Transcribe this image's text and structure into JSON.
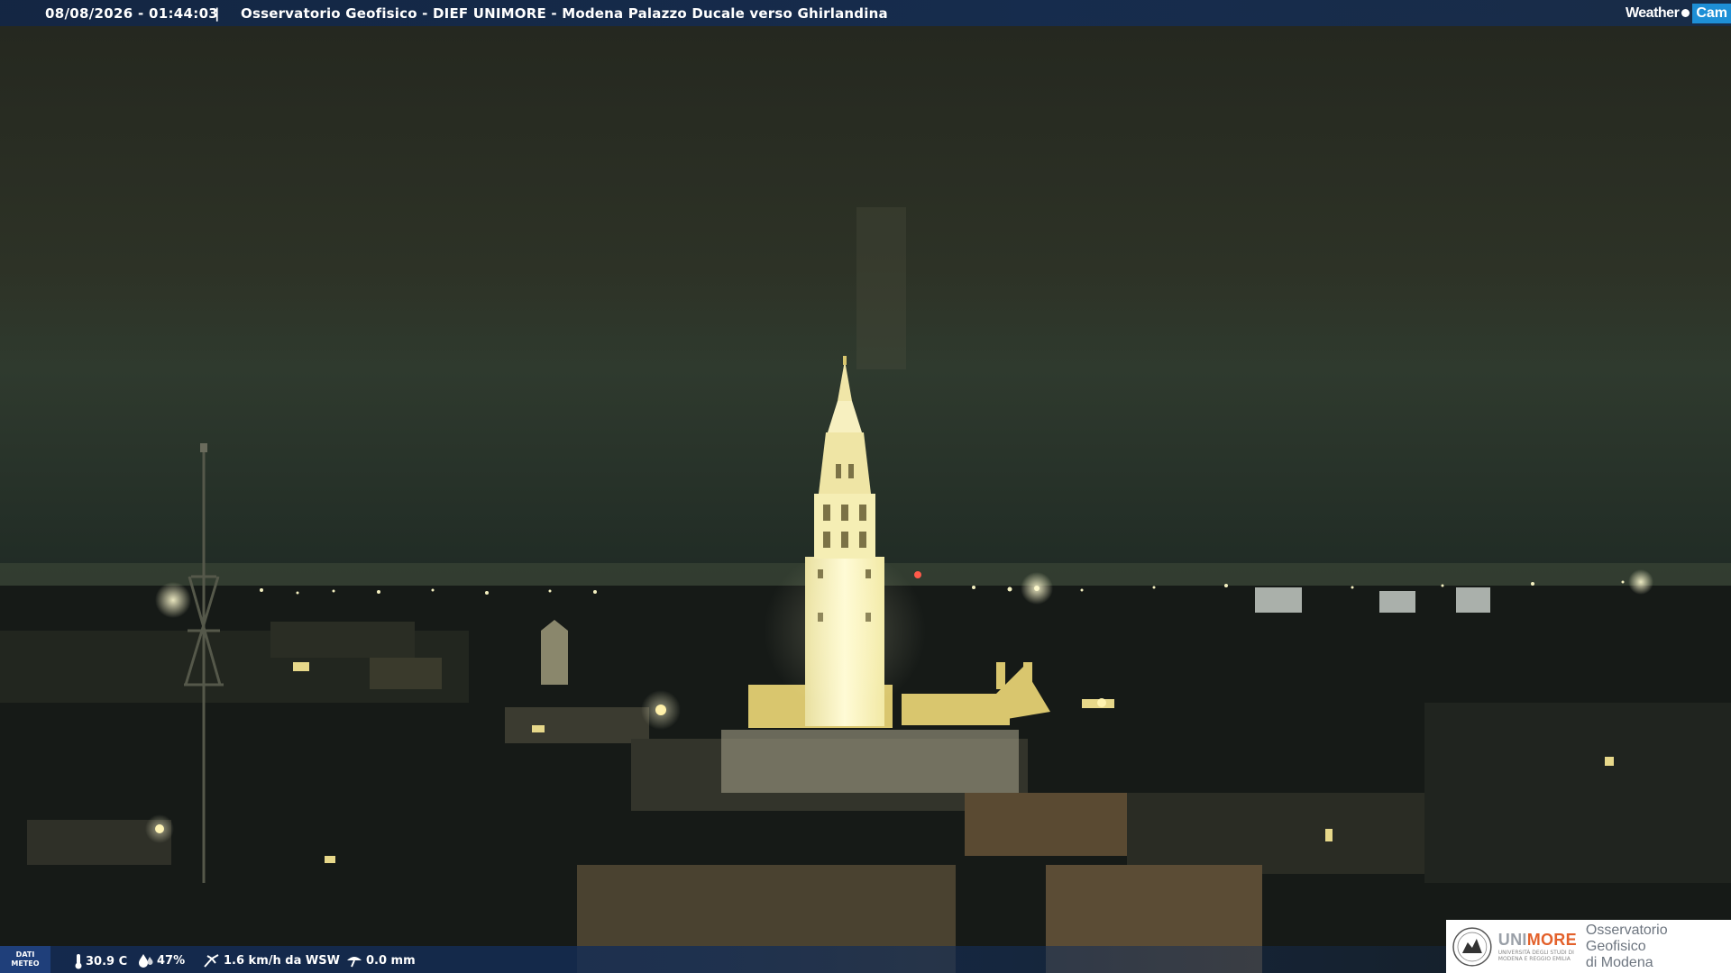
{
  "overlay": {
    "timestamp": "08/08/2026 - 01:44:03",
    "separator": "|",
    "title": "Osservatorio Geofisico - DIEF UNIMORE - Modena Palazzo Ducale verso Ghirlandina",
    "brand_weather": "Weather",
    "brand_cam": "Cam"
  },
  "weather": {
    "dati_label_1": "DATI",
    "dati_label_2": "METEO",
    "temperature": "30.9 C",
    "humidity": "47%",
    "wind": "1.6 km/h da WSW",
    "rain": "0.0 mm",
    "icons": [
      "thermometer-icon",
      "humidity-drop-icon",
      "wind-icon",
      "rain-gauge-icon"
    ]
  },
  "logo": {
    "unimore_prefix": "UNI",
    "unimore_suffix": "MORE",
    "university_line_1": "UNIVERSITÀ DEGLI STUDI DI",
    "university_line_2": "MODENA E REGGIO EMILIA",
    "observatory_line_1": "Osservatorio Geofisico",
    "observatory_line_2": "di Modena"
  },
  "colors": {
    "bar": "#142d55",
    "accent_orange": "#e3612b",
    "brand_blue": "#1e8fd6",
    "tower_light": "#fff6b8"
  }
}
